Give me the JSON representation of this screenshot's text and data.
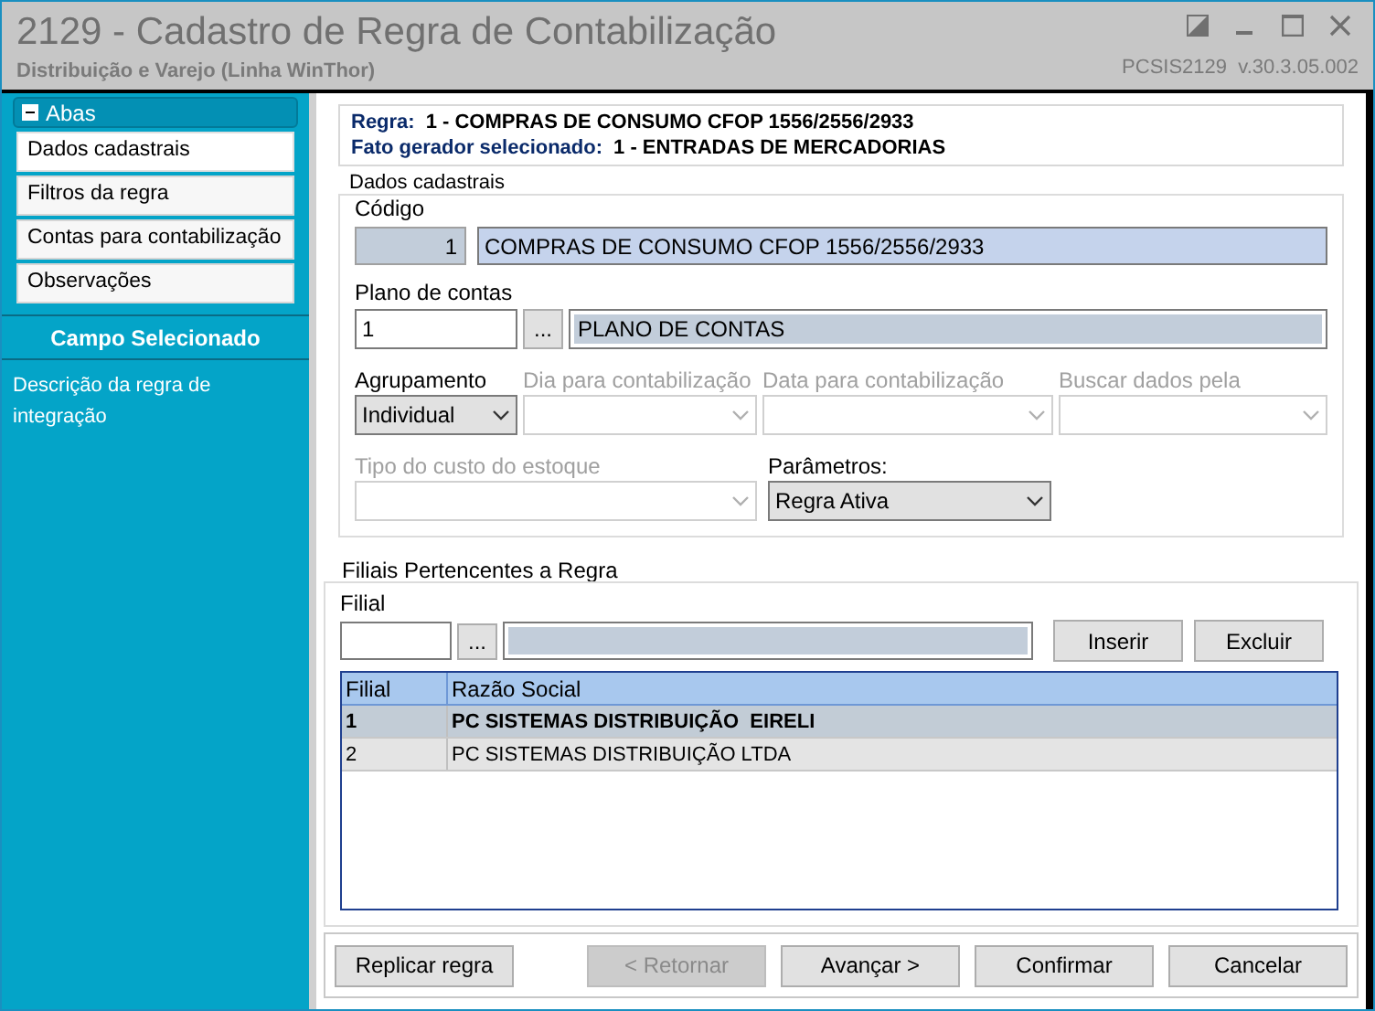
{
  "window": {
    "title": "2129 - Cadastro de Regra de Contabilização",
    "subtitle": "Distribuição e Varejo (Linha WinThor)",
    "version": "PCSIS2129  v.30.3.05.002"
  },
  "sidebar": {
    "header": "Abas",
    "expanded": true,
    "items": [
      {
        "label": "Dados cadastrais",
        "selected": true
      },
      {
        "label": "Filtros da regra",
        "selected": false
      },
      {
        "label": "Contas para contabilização",
        "selected": false
      },
      {
        "label": "Observações",
        "selected": false
      }
    ],
    "section_title": "Campo Selecionado",
    "description": "Descrição da regra de integração"
  },
  "summary": [
    {
      "label": "Regra:",
      "value": "1 - COMPRAS DE CONSUMO CFOP 1556/2556/2933"
    },
    {
      "label": "Fato gerador selecionado:",
      "value": "1 - ENTRADAS DE MERCADORIAS"
    }
  ],
  "dados_cadastrais": {
    "title": "Dados cadastrais",
    "codigo_label": "Código",
    "codigo": "1",
    "descricao": "COMPRAS DE CONSUMO CFOP 1556/2556/2933",
    "plano_label": "Plano de contas",
    "plano_codigo": "1",
    "lookup_button": "...",
    "plano_nome": "PLANO DE CONTAS",
    "selects": [
      {
        "label": "Agrupamento",
        "value": "Individual",
        "disabled": false
      },
      {
        "label": "Dia para contabilização",
        "disabled": true
      },
      {
        "label": "Data para contabilização",
        "disabled": true
      },
      {
        "label": "Buscar dados pela",
        "disabled": true
      },
      {
        "label": "Tipo do custo do estoque",
        "disabled": true
      },
      {
        "label": "Parâmetros:",
        "value": "Regra Ativa",
        "disabled": false
      }
    ]
  },
  "filiais": {
    "title": "Filiais Pertencentes a Regra",
    "filial_label": "Filial",
    "lookup_button": "...",
    "buttons": [
      "Inserir",
      "Excluir"
    ],
    "columns": [
      "Filial",
      "Razão Social"
    ],
    "rows": [
      {
        "filial": "1",
        "razao": "PC SISTEMAS DISTRIBUIÇÃO  EIRELI",
        "selected": true
      },
      {
        "filial": "2",
        "razao": "PC SISTEMAS DISTRIBUIÇÃO LTDA",
        "selected": false
      }
    ]
  },
  "footer_buttons": [
    {
      "label": "Replicar regra",
      "disabled": false
    },
    {
      "label": "< Retornar",
      "disabled": true
    },
    {
      "label": "Avançar >",
      "disabled": false
    },
    {
      "label": "Confirmar",
      "disabled": false
    },
    {
      "label": "Cancelar",
      "disabled": false
    }
  ]
}
